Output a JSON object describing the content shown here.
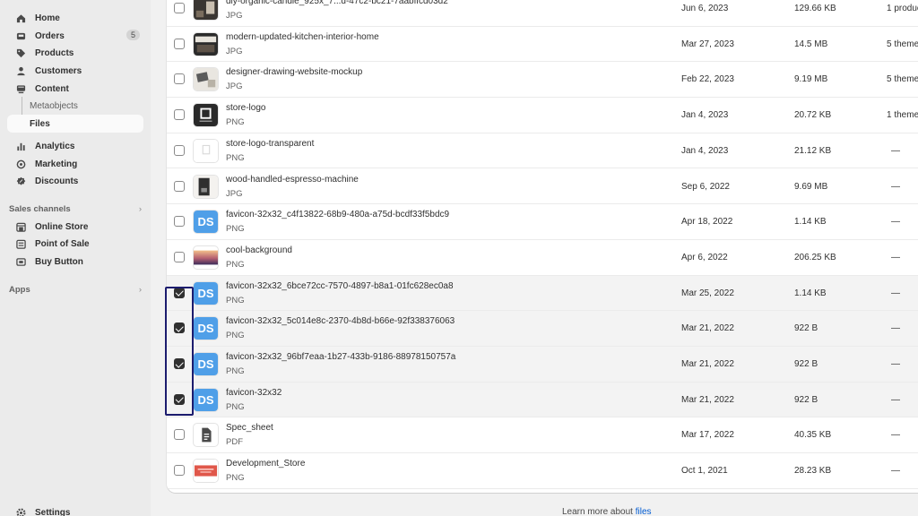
{
  "sidebar": {
    "items": [
      {
        "label": "Home",
        "icon": "home-icon"
      },
      {
        "label": "Orders",
        "icon": "inbox-icon",
        "badge": "5"
      },
      {
        "label": "Products",
        "icon": "tag-icon"
      },
      {
        "label": "Customers",
        "icon": "person-icon"
      },
      {
        "label": "Content",
        "icon": "content-icon"
      },
      {
        "label": "Metaobjects"
      },
      {
        "label": "Files"
      },
      {
        "label": "Analytics",
        "icon": "bar-chart-icon"
      },
      {
        "label": "Marketing",
        "icon": "target-icon"
      },
      {
        "label": "Discounts",
        "icon": "discount-icon"
      }
    ],
    "sales_channels": {
      "title": "Sales channels",
      "items": [
        {
          "label": "Online Store",
          "icon": "store-icon"
        },
        {
          "label": "Point of Sale",
          "icon": "pos-icon"
        },
        {
          "label": "Buy Button",
          "icon": "button-icon"
        }
      ]
    },
    "apps_title": "Apps",
    "settings_label": "Settings"
  },
  "files": [
    {
      "name": "diy-organic-candle_925x_7...d-47c2-bc21-7aabffcd03d2",
      "type": "JPG",
      "date": "Jun 6, 2023",
      "size": "129.66 KB",
      "refs": "1 produc",
      "selected": false,
      "thumb": "photo-dark"
    },
    {
      "name": "modern-updated-kitchen-interior-home",
      "type": "JPG",
      "date": "Mar 27, 2023",
      "size": "14.5 MB",
      "refs": "5 theme",
      "selected": false,
      "thumb": "photo-kitchen"
    },
    {
      "name": "designer-drawing-website-mockup",
      "type": "JPG",
      "date": "Feb 22, 2023",
      "size": "9.19 MB",
      "refs": "5 theme",
      "selected": false,
      "thumb": "photo-desk"
    },
    {
      "name": "store-logo",
      "type": "PNG",
      "date": "Jan 4, 2023",
      "size": "20.72 KB",
      "refs": "1 theme",
      "selected": false,
      "thumb": "logo-dark"
    },
    {
      "name": "store-logo-transparent",
      "type": "PNG",
      "date": "Jan 4, 2023",
      "size": "21.12 KB",
      "refs": "—",
      "selected": false,
      "thumb": "logo-light"
    },
    {
      "name": "wood-handled-espresso-machine",
      "type": "JPG",
      "date": "Sep 6, 2022",
      "size": "9.69 MB",
      "refs": "—",
      "selected": false,
      "thumb": "photo-espresso"
    },
    {
      "name": "favicon-32x32_c4f13822-68b9-480a-a75d-bcdf33f5bdc9",
      "type": "PNG",
      "date": "Apr 18, 2022",
      "size": "1.14 KB",
      "refs": "—",
      "selected": false,
      "thumb": "ds"
    },
    {
      "name": "cool-background",
      "type": "PNG",
      "date": "Apr 6, 2022",
      "size": "206.25 KB",
      "refs": "—",
      "selected": false,
      "thumb": "gradient"
    },
    {
      "name": "favicon-32x32_6bce72cc-7570-4897-b8a1-01fc628ec0a8",
      "type": "PNG",
      "date": "Mar 25, 2022",
      "size": "1.14 KB",
      "refs": "—",
      "selected": true,
      "thumb": "ds"
    },
    {
      "name": "favicon-32x32_5c014e8c-2370-4b8d-b66e-92f338376063",
      "type": "PNG",
      "date": "Mar 21, 2022",
      "size": "922 B",
      "refs": "—",
      "selected": true,
      "thumb": "ds"
    },
    {
      "name": "favicon-32x32_96bf7eaa-1b27-433b-9186-88978150757a",
      "type": "PNG",
      "date": "Mar 21, 2022",
      "size": "922 B",
      "refs": "—",
      "selected": true,
      "thumb": "ds"
    },
    {
      "name": "favicon-32x32",
      "type": "PNG",
      "date": "Mar 21, 2022",
      "size": "922 B",
      "refs": "—",
      "selected": true,
      "thumb": "ds"
    },
    {
      "name": "Spec_sheet",
      "type": "PDF",
      "date": "Mar 17, 2022",
      "size": "40.35 KB",
      "refs": "—",
      "selected": false,
      "thumb": "doc"
    },
    {
      "name": "Development_Store",
      "type": "PNG",
      "date": "Oct 1, 2021",
      "size": "28.23 KB",
      "refs": "—",
      "selected": false,
      "thumb": "banner-red"
    }
  ],
  "ds_text": "DS",
  "footer": {
    "prefix": "Learn more about ",
    "link": "files"
  },
  "colors": {
    "accent_link": "#005bd3",
    "selection_outline": "#1c1c6e",
    "favicon_blue": "#4f9fe8"
  }
}
